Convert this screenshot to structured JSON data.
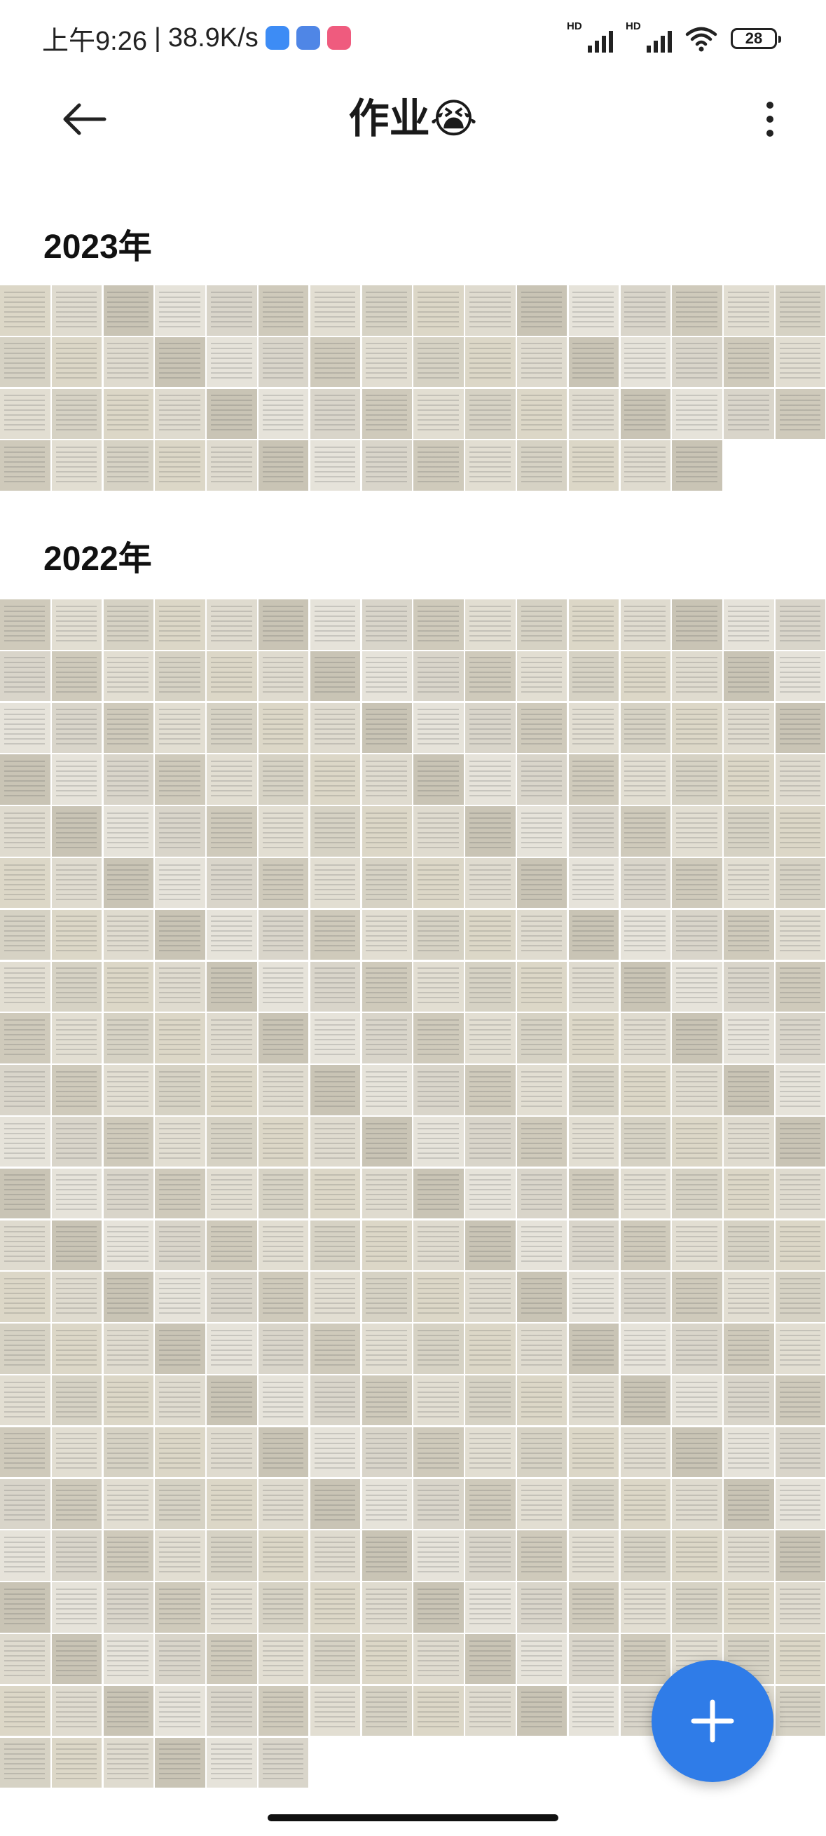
{
  "status_bar": {
    "time": "上午9:26",
    "speed": "38.9K/s",
    "separator": "|",
    "signal1_label": "HD",
    "signal2_label": "HD",
    "battery": "28",
    "app_icon_colors": [
      "#3d8cf5",
      "#4f86e6",
      "#ef5b7e"
    ]
  },
  "header": {
    "title": "作业😭",
    "back_icon": "arrow-left-icon",
    "more_icon": "more-vertical-icon"
  },
  "sections": [
    {
      "year": "2023年",
      "photo_count": 62
    },
    {
      "year": "2022年",
      "photo_count": 358
    }
  ],
  "fab": {
    "icon": "plus-icon",
    "color": "#2f7ce8"
  },
  "thumbnail_palette": [
    "#dcd7c7",
    "#d6d2c4",
    "#e2ded2",
    "#cfcabb",
    "#d9d5ca",
    "#e6e3da",
    "#c9c4b5",
    "#dfdbcf"
  ]
}
